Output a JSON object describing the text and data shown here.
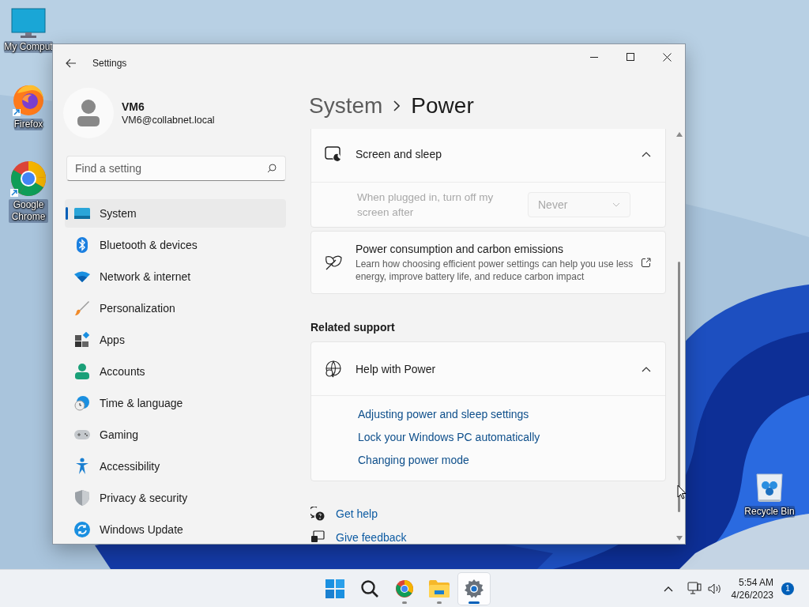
{
  "desktop_icons": [
    {
      "kind": "computer",
      "label": "My Comput"
    },
    {
      "kind": "firefox",
      "label": "Firefox"
    },
    {
      "kind": "chrome",
      "label": "Google Chrome"
    },
    {
      "kind": "recycle-bin",
      "label": "Recycle Bin"
    }
  ],
  "window": {
    "title": "Settings",
    "profile": {
      "name": "VM6",
      "email": "VM6@collabnet.local"
    },
    "search": {
      "placeholder": "Find a setting"
    },
    "nav": [
      {
        "kind": "system",
        "label": "System",
        "selected": true
      },
      {
        "kind": "bluetooth",
        "label": "Bluetooth & devices",
        "selected": false
      },
      {
        "kind": "network",
        "label": "Network & internet",
        "selected": false
      },
      {
        "kind": "personalization",
        "label": "Personalization",
        "selected": false
      },
      {
        "kind": "apps",
        "label": "Apps",
        "selected": false
      },
      {
        "kind": "accounts",
        "label": "Accounts",
        "selected": false
      },
      {
        "kind": "time",
        "label": "Time & language",
        "selected": false
      },
      {
        "kind": "gaming",
        "label": "Gaming",
        "selected": false
      },
      {
        "kind": "accessibility",
        "label": "Accessibility",
        "selected": false
      },
      {
        "kind": "privacy",
        "label": "Privacy & security",
        "selected": false
      },
      {
        "kind": "update",
        "label": "Windows Update",
        "selected": false
      }
    ],
    "breadcrumb": {
      "parent": "System",
      "current": "Power"
    },
    "sections": [
      {
        "kind": "expander",
        "title": "Screen and sleep",
        "expanded": true,
        "rows": [
          {
            "label": "When plugged in, turn off my screen after",
            "value": "Never",
            "disabled": true
          }
        ]
      },
      {
        "kind": "link-card",
        "title": "Power consumption and carbon emissions",
        "description": "Learn how choosing efficient power settings can help you use less energy, improve battery life, and reduce carbon impact"
      }
    ],
    "related_support": {
      "heading": "Related support",
      "title": "Help with Power",
      "expanded": true,
      "links": [
        "Adjusting power and sleep settings",
        "Lock your Windows PC automatically",
        "Changing power mode"
      ]
    },
    "footer_links": [
      {
        "kind": "help",
        "label": "Get help"
      },
      {
        "kind": "feedback",
        "label": "Give feedback"
      }
    ]
  },
  "taskbar": {
    "apps": [
      {
        "kind": "start",
        "selected": false,
        "running": false
      },
      {
        "kind": "search",
        "selected": false,
        "running": false
      },
      {
        "kind": "chrome",
        "selected": false,
        "running": true
      },
      {
        "kind": "explorer",
        "selected": false,
        "running": true
      },
      {
        "kind": "settings",
        "selected": true,
        "running": true
      }
    ],
    "time": "5:54 AM",
    "date": "4/26/2023",
    "notifications": "1"
  }
}
